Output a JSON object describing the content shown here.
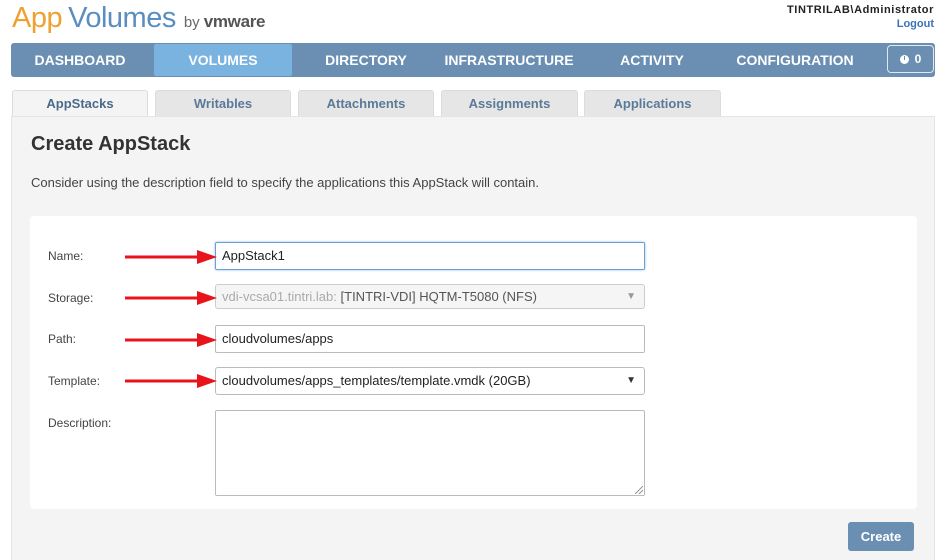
{
  "brand": {
    "app": "App",
    "volumes": "Volumes",
    "by": "by",
    "vendor": "vmware"
  },
  "user": {
    "name": "TINTRILAB\\Administrator",
    "logout": "Logout"
  },
  "nav": {
    "items": [
      {
        "label": "DASHBOARD"
      },
      {
        "label": "VOLUMES"
      },
      {
        "label": "DIRECTORY"
      },
      {
        "label": "INFRASTRUCTURE"
      },
      {
        "label": "ACTIVITY"
      },
      {
        "label": "CONFIGURATION"
      }
    ],
    "active": "VOLUMES",
    "activity_count": "0"
  },
  "tabs": [
    {
      "label": "AppStacks"
    },
    {
      "label": "Writables"
    },
    {
      "label": "Attachments"
    },
    {
      "label": "Assignments"
    },
    {
      "label": "Applications"
    }
  ],
  "page": {
    "title": "Create AppStack",
    "description": "Consider using the description field to specify the applications this AppStack will contain."
  },
  "form": {
    "name_label": "Name:",
    "name_value": "AppStack1",
    "storage_label": "Storage:",
    "storage_prefix": "vdi-vcsa01.tintri.lab:",
    "storage_value": "[TINTRI-VDI] HQTM-T5080 (NFS)",
    "path_label": "Path:",
    "path_value": "cloudvolumes/apps",
    "template_label": "Template:",
    "template_value": "cloudvolumes/apps_templates/template.vmdk (20GB)",
    "description_label": "Description:",
    "description_value": ""
  },
  "actions": {
    "create": "Create"
  },
  "colors": {
    "nav_bg": "#6a8fb3",
    "nav_active": "#7ab2e0",
    "arrow": "#e8141b",
    "logo_orange": "#f0a030",
    "logo_blue": "#5a8ec0"
  }
}
